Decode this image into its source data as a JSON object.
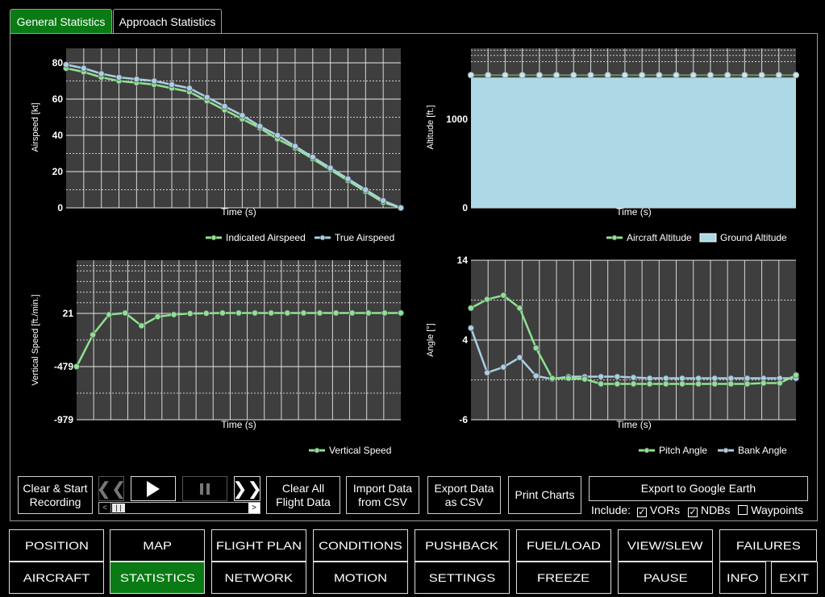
{
  "tabs": [
    {
      "label": "General Statistics",
      "active": true
    },
    {
      "label": "Approach Statistics",
      "active": false
    }
  ],
  "charts": {
    "airspeed": {
      "ylabel": "Airspeed [kt]",
      "xlabel": "Time (s)",
      "yticks": [
        "80",
        "60",
        "40",
        "20",
        "0"
      ],
      "legend": [
        "Indicated Airspeed",
        "True Airspeed"
      ]
    },
    "altitude": {
      "ylabel": "Altitude [ft.]",
      "xlabel": "Time (s)",
      "yticks": [
        "1000",
        "0"
      ],
      "legend": [
        "Aircraft Altitude",
        "Ground Altitude"
      ]
    },
    "vspeed": {
      "ylabel": "Vertical Speed [ft./min.]",
      "xlabel": "Time (s)",
      "yticks": [
        "21",
        "-479",
        "-979"
      ],
      "legend": [
        "Vertical Speed"
      ]
    },
    "angle": {
      "ylabel": "Angle [°]",
      "xlabel": "Time (s)",
      "yticks": [
        "14",
        "4",
        "-6"
      ],
      "legend": [
        "Pitch Angle",
        "Bank Angle"
      ]
    }
  },
  "chart_data": [
    {
      "type": "line",
      "ylabel": "Airspeed [kt]",
      "xlabel": "Time (s)",
      "ylim": [
        0,
        88
      ],
      "series": [
        {
          "name": "Indicated Airspeed",
          "values": [
            77,
            75,
            72,
            70,
            69,
            68,
            66,
            64,
            59,
            54,
            49,
            44,
            38,
            33,
            27,
            21,
            15,
            9,
            3,
            0
          ]
        },
        {
          "name": "True Airspeed",
          "values": [
            79,
            77,
            74,
            72,
            71,
            70,
            68,
            66,
            61,
            56,
            51,
            45,
            40,
            34,
            28,
            22,
            16,
            10,
            4,
            0
          ]
        }
      ]
    },
    {
      "type": "area",
      "ylabel": "Altitude [ft.]",
      "xlabel": "Time (s)",
      "ylim": [
        0,
        1800
      ],
      "series": [
        {
          "name": "Aircraft Altitude",
          "values": [
            1480,
            1480,
            1480,
            1480,
            1480,
            1480,
            1480,
            1480,
            1480,
            1480,
            1480,
            1480,
            1480,
            1480,
            1480,
            1480,
            1480,
            1480,
            1480,
            1480
          ]
        },
        {
          "name": "Ground Altitude",
          "values": [
            1470,
            1470,
            1470,
            1470,
            1470,
            1470,
            1470,
            1470,
            1470,
            1470,
            1470,
            1470,
            1470,
            1470,
            1470,
            1470,
            1470,
            1470,
            1470,
            1470
          ]
        }
      ]
    },
    {
      "type": "line",
      "ylabel": "Vertical Speed [ft./min.]",
      "xlabel": "Time (s)",
      "ylim": [
        -979,
        521
      ],
      "series": [
        {
          "name": "Vertical Speed",
          "values": [
            -479,
            -180,
            10,
            25,
            -95,
            -10,
            10,
            20,
            22,
            25,
            25,
            25,
            25,
            25,
            25,
            25,
            25,
            25,
            25,
            25,
            25
          ]
        }
      ]
    },
    {
      "type": "line",
      "ylabel": "Angle [°]",
      "xlabel": "Time (s)",
      "ylim": [
        -6,
        14
      ],
      "series": [
        {
          "name": "Pitch Angle",
          "values": [
            8.0,
            9.1,
            9.6,
            8.0,
            3.0,
            -0.8,
            -0.8,
            -0.9,
            -1.5,
            -1.5,
            -1.5,
            -1.5,
            -1.5,
            -1.5,
            -1.5,
            -1.5,
            -1.5,
            -1.5,
            -1.4,
            -1.4,
            -0.4
          ]
        },
        {
          "name": "Bank Angle",
          "values": [
            5.5,
            -0.1,
            0.6,
            1.8,
            -0.5,
            -0.9,
            -0.6,
            -0.6,
            -0.6,
            -0.6,
            -0.7,
            -0.8,
            -0.8,
            -0.8,
            -0.8,
            -0.8,
            -0.8,
            -0.8,
            -0.8,
            -0.8,
            -0.8
          ]
        }
      ]
    }
  ],
  "controls": {
    "clear_start": "Clear & Start\nRecording",
    "clear_all": "Clear All\nFlight Data",
    "import_csv": "Import Data\nfrom CSV",
    "export_csv": "Export Data\nas CSV",
    "print_charts": "Print Charts",
    "export_ge": "Export to Google Earth",
    "include_label": "Include:",
    "include_vors": "VORs",
    "include_ndbs": "NDBs",
    "include_waypoints": "Waypoints"
  },
  "nav_row1": [
    "POSITION",
    "MAP",
    "FLIGHT PLAN",
    "CONDITIONS",
    "PUSHBACK",
    "FUEL/LOAD",
    "VIEW/SLEW",
    "FAILURES"
  ],
  "nav_row2": [
    "AIRCRAFT",
    "STATISTICS",
    "NETWORK",
    "MOTION",
    "SETTINGS",
    "FREEZE",
    "PAUSE",
    "INFO",
    "EXIT"
  ],
  "colors": {
    "green_line": "#8fe28f",
    "blue_line": "#aacfe0",
    "plot_bg": "#3e3e3e",
    "ground_fill": "#add8e6",
    "active": "#0a7b14"
  }
}
